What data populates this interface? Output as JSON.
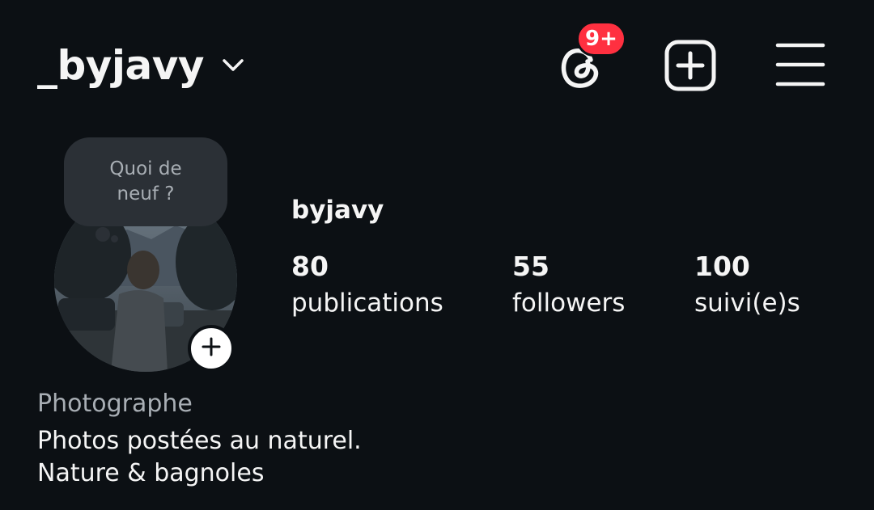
{
  "header": {
    "username": "_byjavy",
    "account_switcher_icon": "chevron-down-icon",
    "threads_icon": "threads-icon",
    "notification_badge": "9+",
    "create_icon": "plus-square-icon",
    "menu_icon": "hamburger-menu-icon"
  },
  "profile": {
    "note_text": "Quoi de neuf ?",
    "avatar_icon": "profile-photo",
    "add_story_icon": "plus-icon",
    "display_name": "byjavy",
    "stats": [
      {
        "value": "80",
        "label": "publications"
      },
      {
        "value": "55",
        "label": "followers"
      },
      {
        "value": "100",
        "label": "suivi(e)s"
      }
    ]
  },
  "bio": {
    "category": "Photographe",
    "lines": [
      "Photos postées au naturel.",
      "Nature & bagnoles"
    ]
  },
  "colors": {
    "background": "#0c1014",
    "text": "#f5f5f5",
    "muted": "#a8aeb4",
    "badge": "#ff3040",
    "bubble": "#2b3036"
  }
}
